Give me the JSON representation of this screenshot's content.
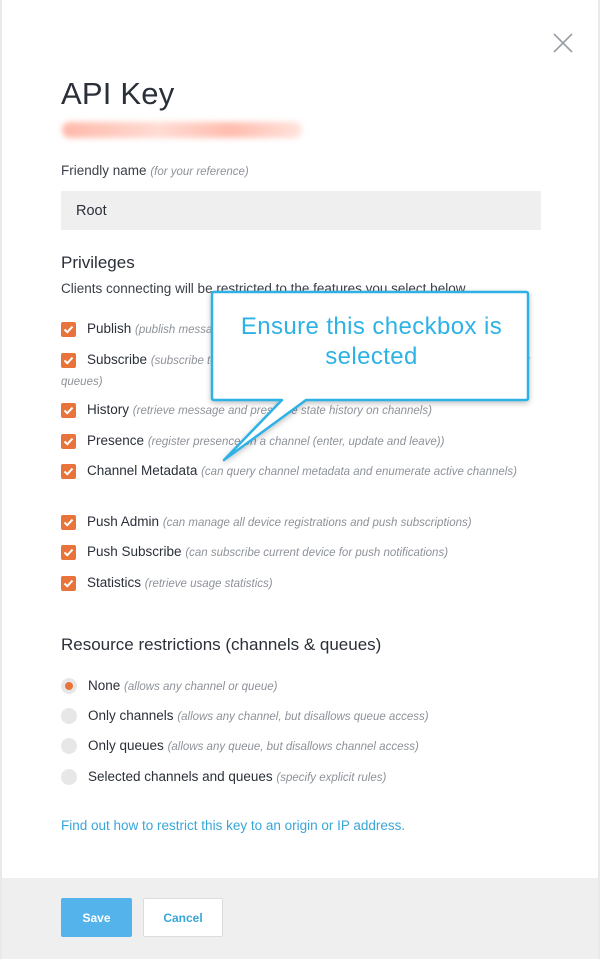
{
  "dialog": {
    "title": "API Key",
    "friendly_name": {
      "label": "Friendly name",
      "hint": "(for your reference)",
      "value": "Root"
    }
  },
  "privileges": {
    "title": "Privileges",
    "description": "Clients connecting will be restricted to the features you select below.",
    "items": [
      {
        "label": "Publish",
        "hint": "(publish messages to channels or queues)",
        "checked": true
      },
      {
        "label": "Subscribe",
        "hint": "(subscribe to messages and presence state change events on channels or queues)",
        "checked": true
      },
      {
        "label": "History",
        "hint": "(retrieve message and presence state history on channels)",
        "checked": true
      },
      {
        "label": "Presence",
        "hint": "(register presence on a channel (enter, update and leave))",
        "checked": true
      },
      {
        "label": "Channel Metadata",
        "hint": "(can query channel metadata and enumerate active channels)",
        "checked": true
      },
      {
        "label": "Push Admin",
        "hint": "(can manage all device registrations and push subscriptions)",
        "checked": true
      },
      {
        "label": "Push Subscribe",
        "hint": "(can subscribe current device for push notifications)",
        "checked": true
      },
      {
        "label": "Statistics",
        "hint": "(retrieve usage statistics)",
        "checked": true
      }
    ]
  },
  "resource_restrictions": {
    "title": "Resource restrictions (channels & queues)",
    "options": [
      {
        "label": "None",
        "hint": "(allows any channel or queue)",
        "selected": true
      },
      {
        "label": "Only channels",
        "hint": "(allows any channel, but disallows queue access)",
        "selected": false
      },
      {
        "label": "Only queues",
        "hint": "(allows any queue, but disallows channel access)",
        "selected": false
      },
      {
        "label": "Selected channels and queues",
        "hint": "(specify explicit rules)",
        "selected": false
      }
    ]
  },
  "restrict_link": "Find out how to restrict this key to an origin or IP address.",
  "footer": {
    "save_label": "Save",
    "cancel_label": "Cancel"
  },
  "callout": {
    "line1": "Ensure this checkbox is",
    "line2": "selected"
  },
  "colors": {
    "accent": "#e8743b",
    "link": "#39a6d8",
    "primary_button": "#55b3ec",
    "callout": "#2eb2e6"
  },
  "icons": {
    "close": "close-icon",
    "checkbox": "checkmark-icon"
  }
}
